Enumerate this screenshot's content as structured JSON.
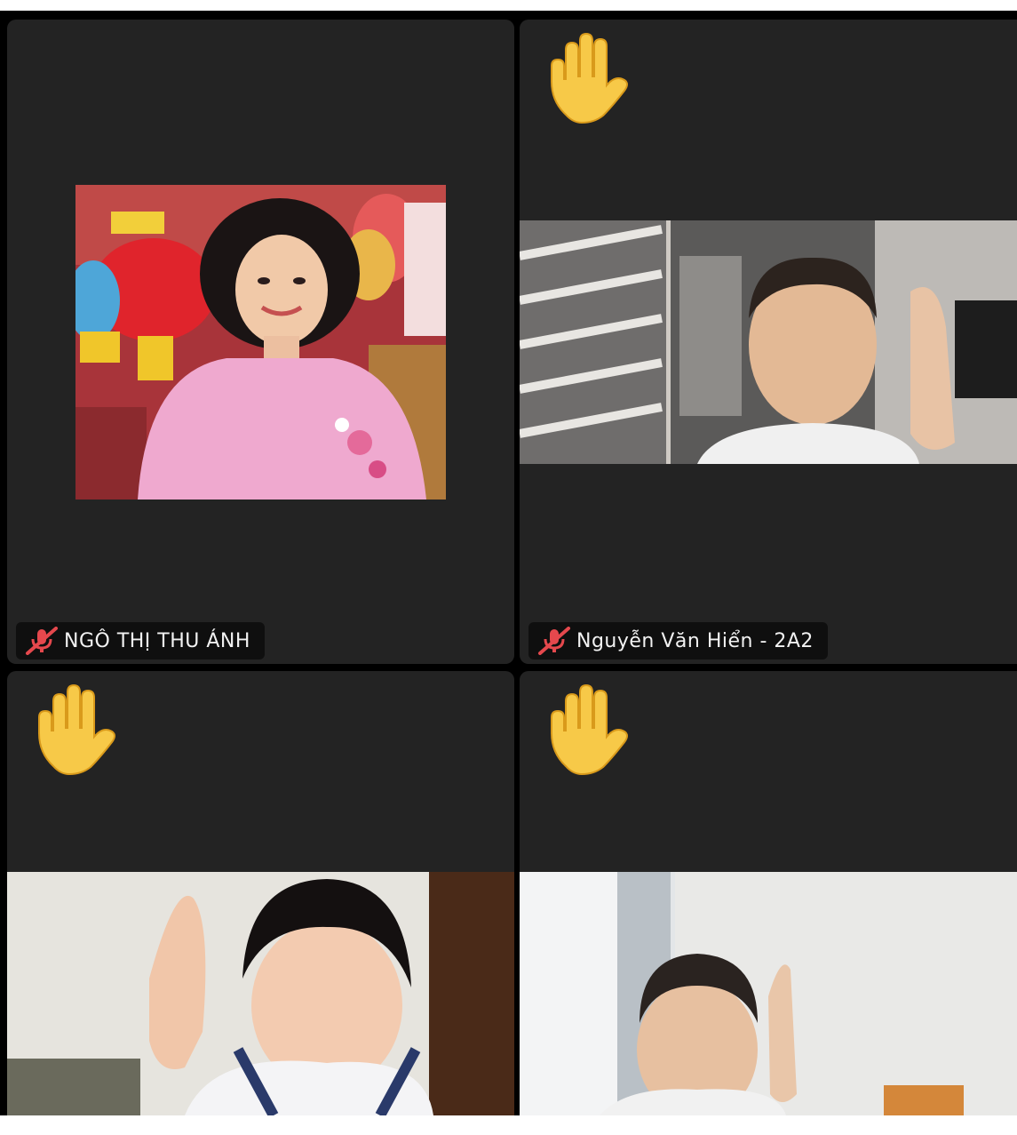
{
  "participants": [
    {
      "name": "NGÔ THỊ THU ÁNH",
      "muted": true,
      "hand_raised": false
    },
    {
      "name": "Nguyễn Văn Hiển - 2A2",
      "muted": true,
      "hand_raised": true
    },
    {
      "name": "",
      "muted": false,
      "hand_raised": true
    },
    {
      "name": "",
      "muted": false,
      "hand_raised": true
    }
  ],
  "colors": {
    "tile_bg": "#232323",
    "mute_icon": "#e5484d",
    "hand_emoji": "#f7c948"
  },
  "icons": {
    "muted": "muted-mic-icon",
    "hand": "raised-hand-icon"
  }
}
